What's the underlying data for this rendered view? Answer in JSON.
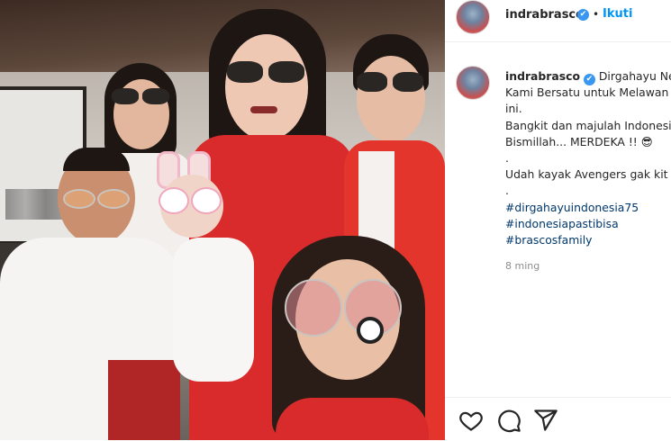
{
  "post": {
    "username": "indrabrasco",
    "follow_label": "Ikuti",
    "separator": "•",
    "verified_mark": "✔"
  },
  "caption": {
    "username": "indrabrasco",
    "lines": [
      "Dirgahayu Ne",
      "Kami Bersatu untuk Melawan",
      "ini.",
      "Bangkit dan majulah Indonesi",
      "Bismillah... MERDEKA !! 😎",
      ".",
      "Udah kayak Avengers gak kit",
      "."
    ],
    "hashtags": [
      "#dirgahayuindonesia75",
      "#indonesiapastibisa",
      "#brascosfamily"
    ],
    "time": "8 ming"
  },
  "actions": {
    "icons": [
      "heart-icon",
      "comment-icon",
      "share-icon"
    ]
  },
  "colors": {
    "link": "#00376b",
    "follow": "#0095f6",
    "verified": "#3897f0",
    "text": "#262626",
    "muted": "#8e8e8e"
  }
}
